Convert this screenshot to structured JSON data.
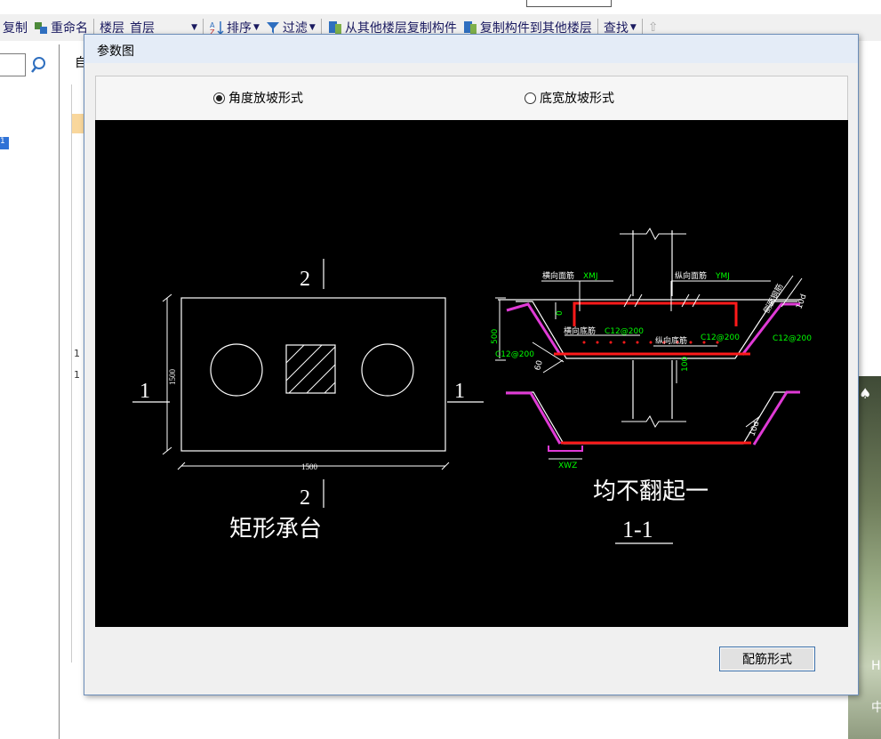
{
  "toolbar": {
    "copy": "复制",
    "rename": "重命名",
    "floor_label": "楼层",
    "floor_value": "首层",
    "sort": "排序",
    "filter": "过滤",
    "copy_from_floor": "从其他楼层复制构件",
    "copy_to_floor": "复制构件到其他楼层",
    "find": "查找"
  },
  "left_pane": {
    "tree_item_fragment": "1"
  },
  "mid_column": {
    "header_fragment": "自",
    "row_marks": [
      "1",
      "1"
    ]
  },
  "dialog": {
    "title": "参数图",
    "radio_angle": "角度放坡形式",
    "radio_width": "底宽放坡形式",
    "selected": "angle",
    "rebar_button": "配筋形式"
  },
  "drawing": {
    "section_2_top": "2",
    "section_2_bottom": "2",
    "section_1_left": "1",
    "section_1_right": "1",
    "dim_height": "1500",
    "dim_width": "1500",
    "caption_left": "矩形承台",
    "caption_right": "均不翻起一",
    "section_label": "1-1",
    "lbl_transverse_top": "横向面筋",
    "lbl_transverse_top_code": "XMJ",
    "lbl_longitudinal_top": "纵向面筋",
    "lbl_longitudinal_top_code": "YMJ",
    "lbl_transverse_bottom": "横向底筋",
    "lbl_transverse_bottom_spec": "C12@200",
    "lbl_longitudinal_bottom": "纵向底筋",
    "lbl_longitudinal_bottom_spec": "C12@200",
    "lbl_side_spec_right": "C12@200",
    "lbl_side_spec_left": "C12@200",
    "lbl_side_rebar": "侧面钢筋",
    "dim_500": "500",
    "dim_0": "0",
    "dim_100": "100",
    "dim_60": "60",
    "dim_10d_a": "10d",
    "dim_10d_b": "10d",
    "lbl_xwz": "XWZ"
  },
  "right_edge": {
    "frag_h": "H",
    "frag_zhong": "中"
  }
}
